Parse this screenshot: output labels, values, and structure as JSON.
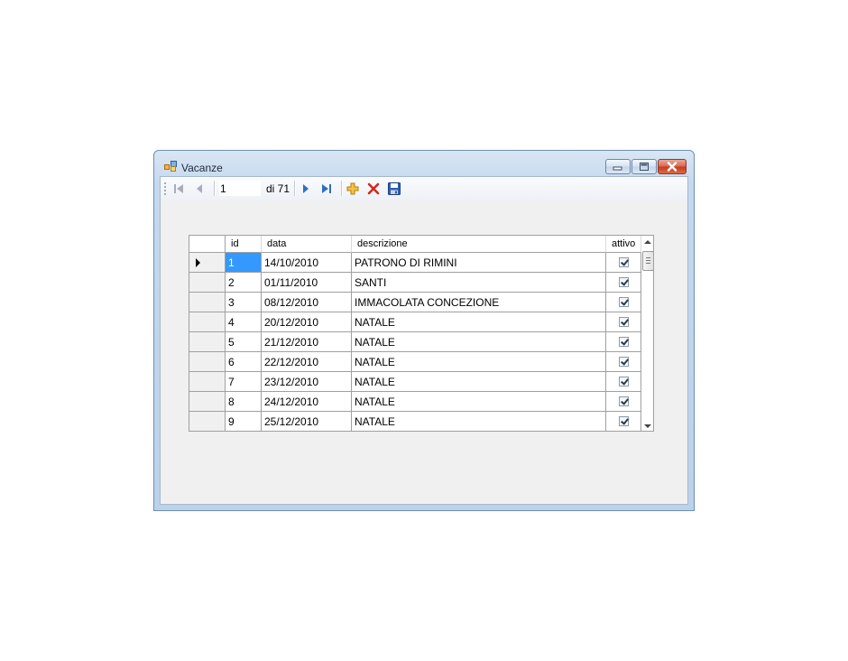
{
  "window": {
    "title": "Vacanze"
  },
  "navigator": {
    "position": "1",
    "count_label": "di 71",
    "buttons": {
      "first": "move-first-icon",
      "previous": "move-previous-icon",
      "next": "move-next-icon",
      "last": "move-last-icon",
      "add": "add-new-icon",
      "delete": "delete-icon",
      "save": "save-icon"
    }
  },
  "grid": {
    "columns": [
      "id",
      "data",
      "descrizione",
      "attivo"
    ],
    "rows": [
      {
        "id": "1",
        "data": "14/10/2010",
        "descrizione": "PATRONO DI RIMINI",
        "attivo": true
      },
      {
        "id": "2",
        "data": "01/11/2010",
        "descrizione": "SANTI",
        "attivo": true
      },
      {
        "id": "3",
        "data": "08/12/2010",
        "descrizione": "IMMACOLATA CONCEZIONE",
        "attivo": true
      },
      {
        "id": "4",
        "data": "20/12/2010",
        "descrizione": "NATALE",
        "attivo": true
      },
      {
        "id": "5",
        "data": "21/12/2010",
        "descrizione": "NATALE",
        "attivo": true
      },
      {
        "id": "6",
        "data": "22/12/2010",
        "descrizione": "NATALE",
        "attivo": true
      },
      {
        "id": "7",
        "data": "23/12/2010",
        "descrizione": "NATALE",
        "attivo": true
      },
      {
        "id": "8",
        "data": "24/12/2010",
        "descrizione": "NATALE",
        "attivo": true
      },
      {
        "id": "9",
        "data": "25/12/2010",
        "descrizione": "NATALE",
        "attivo": true
      }
    ]
  },
  "colors": {
    "selection": "#3399ff",
    "title_bar": "#c4d8ee",
    "close_button": "#c7391c"
  }
}
